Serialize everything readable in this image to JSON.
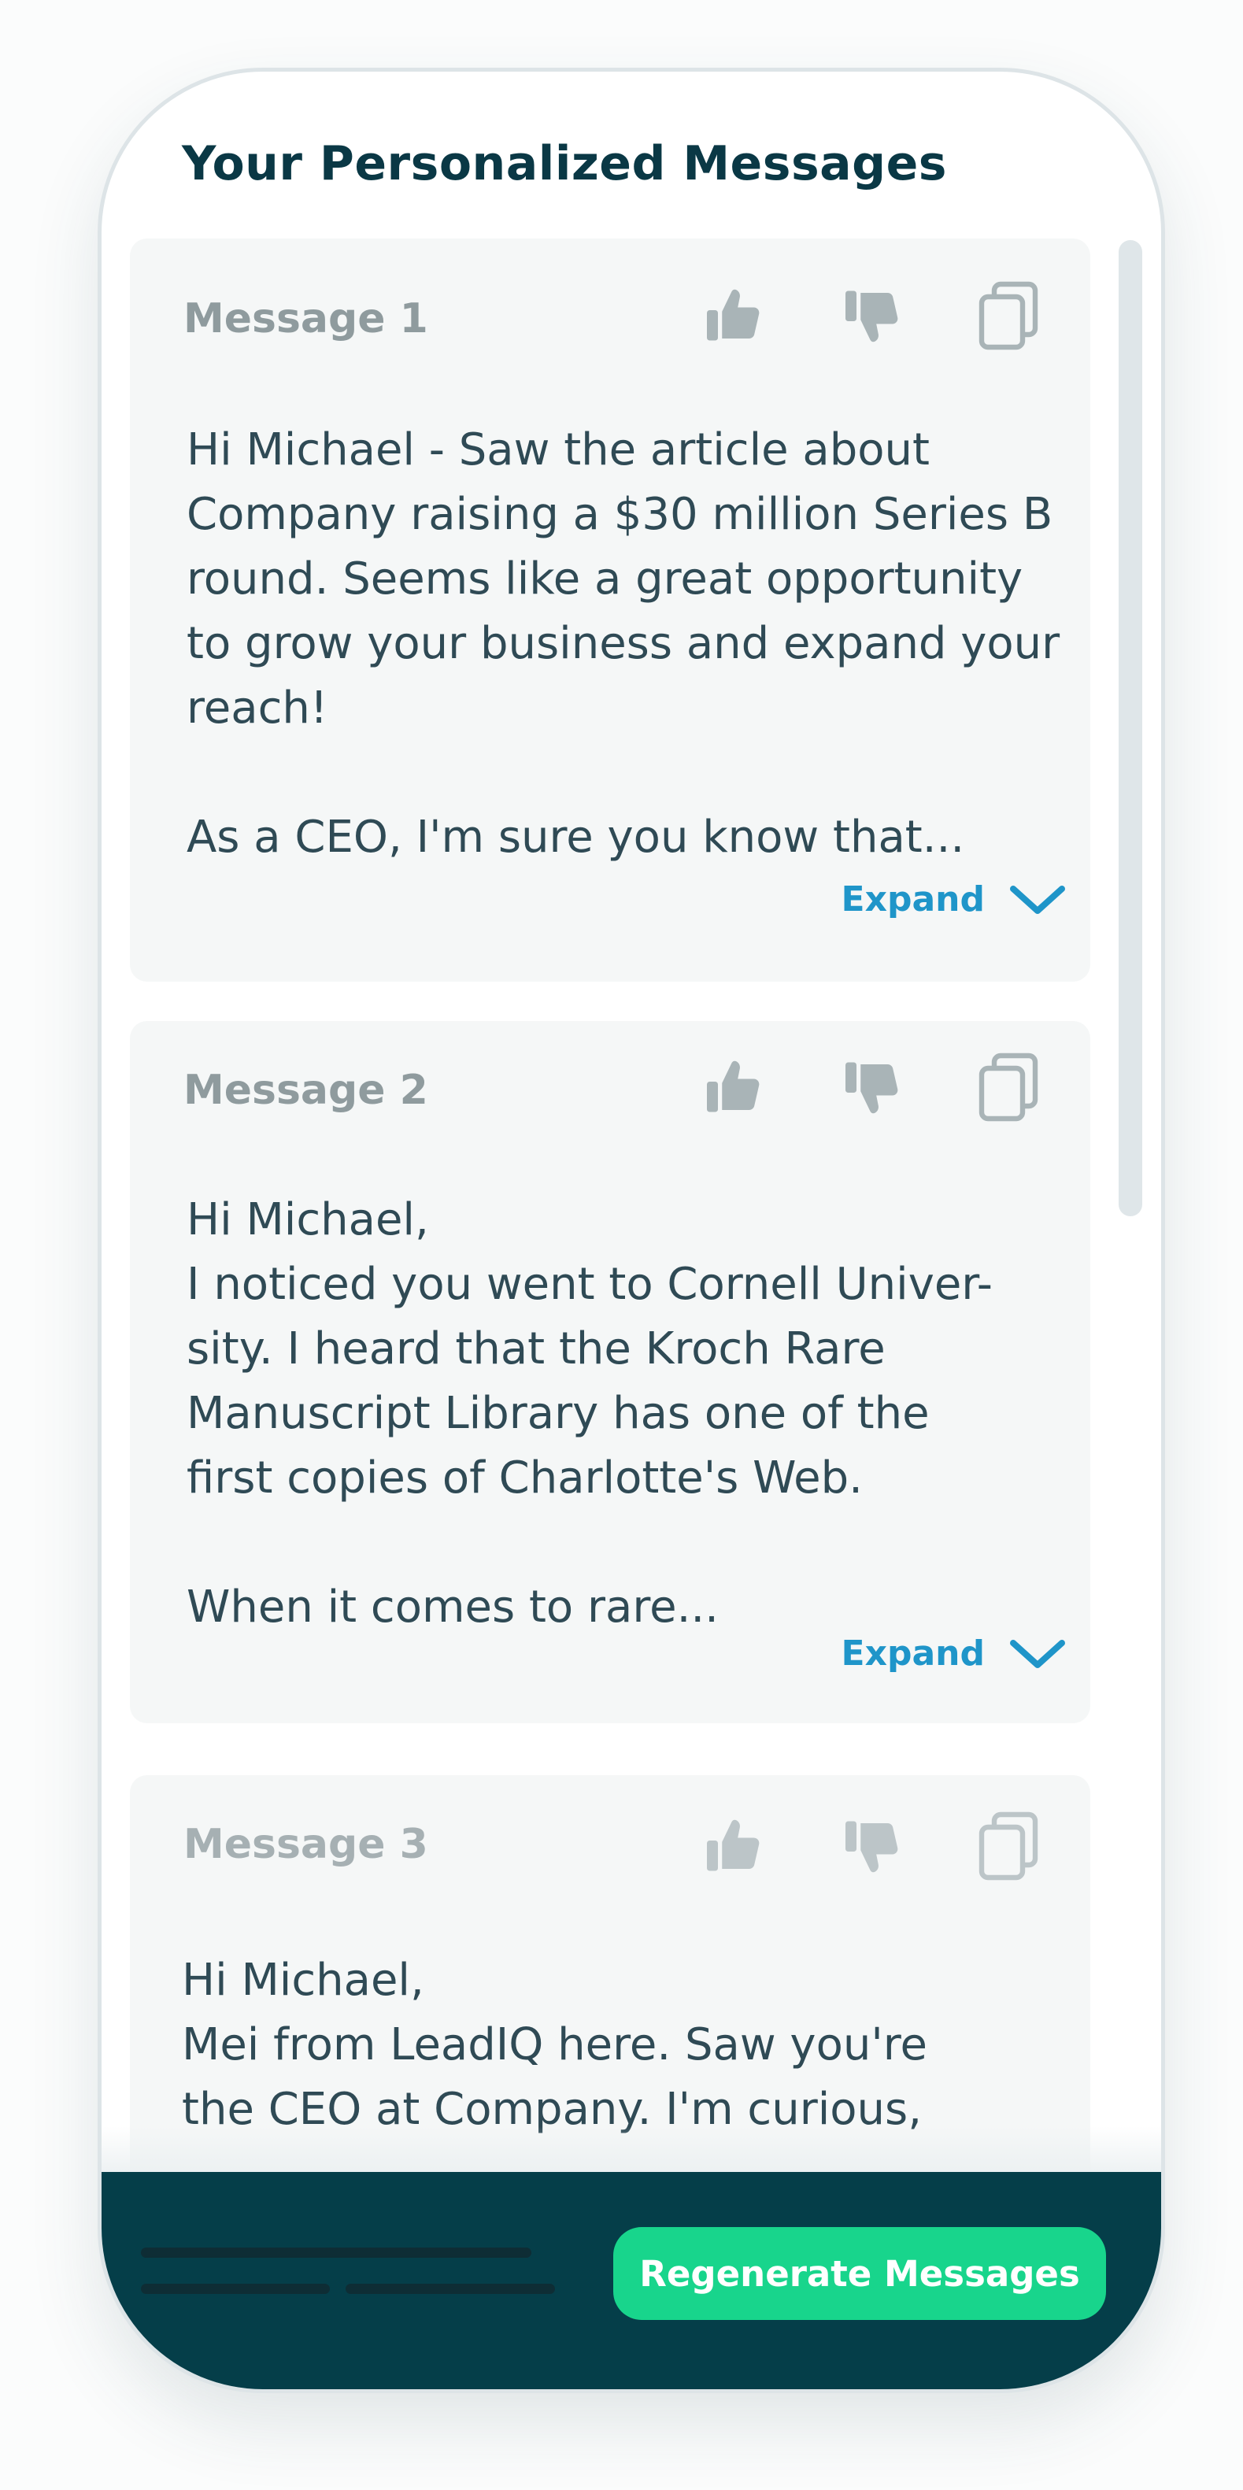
{
  "page_title": "Your Personalized Messages",
  "colors": {
    "accent_expand": "#1f95c9",
    "button_green": "#18d58c",
    "footer_bg": "#053e49",
    "title_text": "#0a3845"
  },
  "messages": [
    {
      "label": "Message 1",
      "body": "Hi Michael - Saw the article about\nCompany raising a $30 million Series B\nround. Seems like a great opportunity\nto grow your business and expand your\nreach!\n\nAs a CEO, I'm sure you know that...",
      "expand_label": "Expand"
    },
    {
      "label": "Message 2",
      "body": "Hi Michael,\nI noticed you went to Cornell Univer-\nsity. I heard that the Kroch Rare\nManuscript Library has one of the\nfirst copies of Charlotte's Web.\n\nWhen it comes to rare...",
      "expand_label": "Expand"
    },
    {
      "label": "Message 3",
      "body": "Hi Michael,\nMei from LeadIQ here. Saw you're\nthe CEO at Company. I'm curious,"
    }
  ],
  "icons": {
    "like": "thumbs-up-icon",
    "dislike": "thumbs-down-icon",
    "copy": "copy-icon",
    "expand": "chevron-down-icon"
  },
  "footer": {
    "regenerate_label": "Regenerate Messages"
  }
}
